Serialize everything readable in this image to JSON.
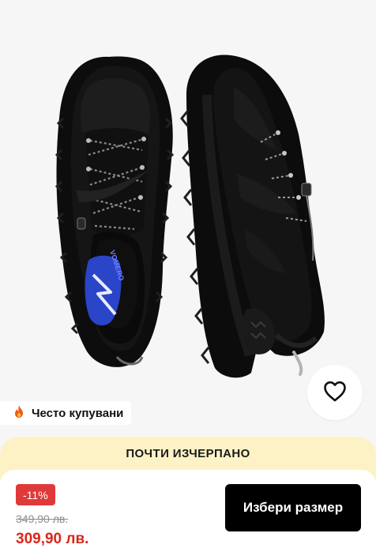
{
  "product": {
    "brand_print": "VOMERO",
    "image_alt": "Black running sneakers, top and side view"
  },
  "popular_tag": {
    "icon": "fire-icon",
    "label": "Често купувани"
  },
  "favorite": {
    "icon": "heart-icon"
  },
  "scarcity_banner": {
    "text": "ПОЧТИ ИЗЧЕРПАНО"
  },
  "pricing": {
    "discount": "-11%",
    "old_price": "349,90 лв.",
    "new_price": "309,90 лв."
  },
  "actions": {
    "select_size_label": "Избери размер"
  },
  "colors": {
    "background": "#f6f6f6",
    "banner": "#fdf2c6",
    "discount": "#e0393a",
    "price": "#d9261c",
    "cta": "#000000",
    "insole_accent": "#2a45c8"
  }
}
